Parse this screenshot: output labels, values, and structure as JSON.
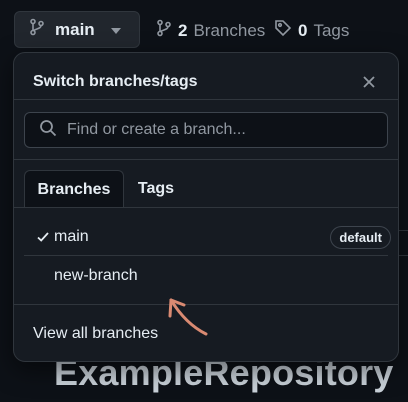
{
  "toolbar": {
    "current_branch": "main",
    "branches_count": "2",
    "branches_label": "Branches",
    "tags_count": "0",
    "tags_label": "Tags"
  },
  "dropdown": {
    "title": "Switch branches/tags",
    "search_placeholder": "Find or create a branch...",
    "tabs": [
      {
        "label": "Branches",
        "active": true
      },
      {
        "label": "Tags",
        "active": false
      }
    ],
    "branches": [
      {
        "name": "main",
        "selected": true,
        "badge": "default"
      },
      {
        "name": "new-branch",
        "selected": false,
        "badge": ""
      }
    ],
    "view_all_label": "View all branches"
  },
  "background": {
    "repo_title": "ExampleRepository"
  },
  "colors": {
    "accent_arrow": "#d98a72",
    "panel_bg": "#161b22",
    "page_bg": "#0d1117",
    "border": "#30363d"
  }
}
